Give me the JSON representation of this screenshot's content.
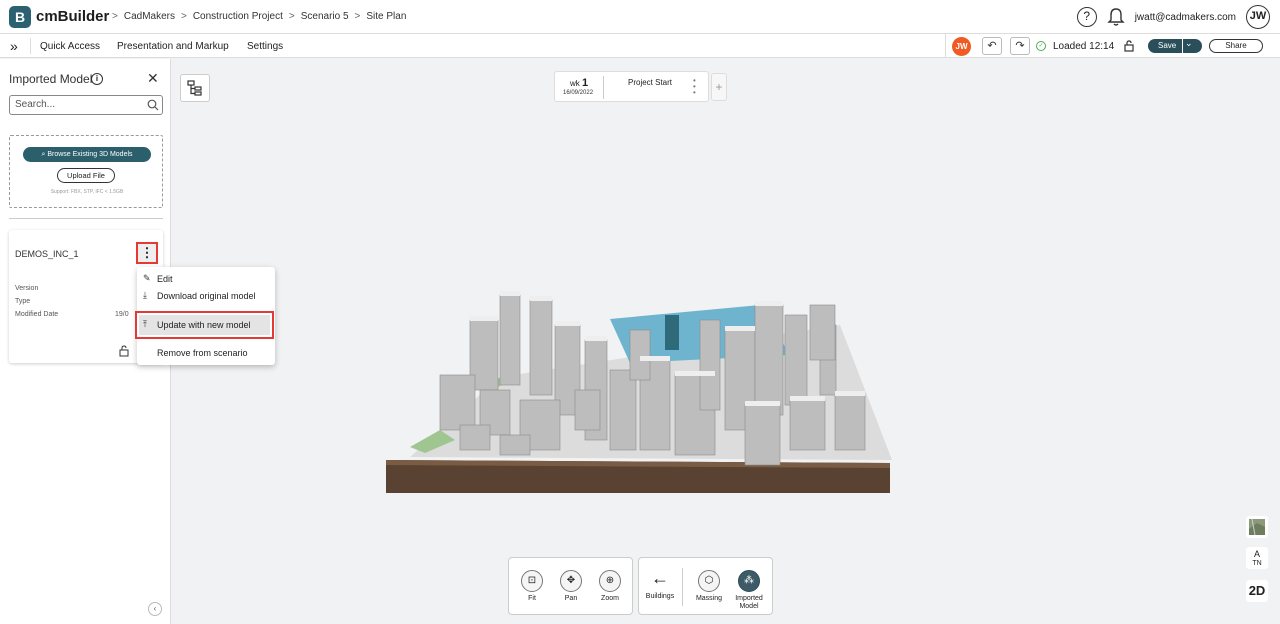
{
  "app": {
    "name": "cmBuilder",
    "logo_letter": "B"
  },
  "breadcrumbs": [
    "CadMakers",
    "Construction Project",
    "Scenario 5",
    "Site Plan"
  ],
  "header": {
    "help": "?",
    "bell": "🔔",
    "email": "jwatt@cadmakers.com",
    "avatar": "JW"
  },
  "menu": {
    "expand": "»",
    "items": [
      "Quick Access",
      "Presentation and Markup",
      "Settings"
    ],
    "user_badge": "JW",
    "undo": "↶",
    "redo": "↷",
    "status": "Loaded 12:14",
    "lock": "🔓",
    "save": "Save",
    "save_caret": "⌄",
    "share": "Share"
  },
  "sidebar": {
    "title": "Imported Model",
    "info": "i",
    "close": "✕",
    "search_placeholder": "Search...",
    "browse": "Browse Existing 3D Models",
    "upload": "Upload File",
    "support": "Support: FBX, STP, IFC < 1.5GB",
    "model": {
      "name": "DEMOS_INC_1",
      "kebab": "⋮",
      "version_label": "Version",
      "type_label": "Type",
      "modified_label": "Modified Date",
      "modified_value": "19/0"
    },
    "collapse": "‹"
  },
  "context_menu": {
    "items": [
      "Edit",
      "Download original model",
      "Update with new model",
      "Remove from scenario"
    ]
  },
  "timeline": {
    "wk_label": "wk",
    "wk_num": "1",
    "date": "16/09/2022",
    "label": "Project Start",
    "add": "+"
  },
  "right_tools": {
    "north": "TN",
    "north_arrow": "A",
    "view2d": "2D"
  },
  "bottom_tools": {
    "nav": [
      {
        "label": "Fit",
        "icon": "⊡"
      },
      {
        "label": "Pan",
        "icon": "✥"
      },
      {
        "label": "Zoom",
        "icon": "⊕"
      }
    ],
    "back": "←",
    "layers": [
      {
        "label": "Buildings"
      },
      {
        "label": "Massing",
        "icon": "⬡"
      },
      {
        "label": "Imported Model",
        "icon": "⁂"
      }
    ]
  }
}
